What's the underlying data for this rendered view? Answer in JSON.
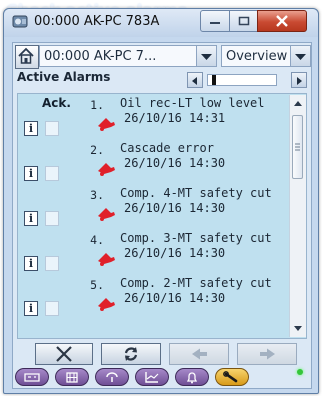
{
  "caption": "Check active alarms",
  "window": {
    "title": "00:000 AK-PC 783A",
    "minimize_label": "Minimize",
    "maximize_label": "Maximize",
    "close_label": "Close"
  },
  "toolbar": {
    "device_select": "00:000 AK-PC 7...",
    "view_select": "Overview"
  },
  "alarms": {
    "title": "Active Alarms",
    "ack_header": "Ack.",
    "info_label": "i",
    "items": [
      {
        "num": "1.",
        "text": "Oil rec-LT low level",
        "time": "26/10/16 14:31"
      },
      {
        "num": "2.",
        "text": "Cascade error",
        "time": "26/10/16 14:30"
      },
      {
        "num": "3.",
        "text": "Comp. 4-MT safety cut",
        "time": "26/10/16 14:30"
      },
      {
        "num": "4.",
        "text": "Comp. 3-MT safety cut",
        "time": "26/10/16 14:30"
      },
      {
        "num": "5.",
        "text": "Comp. 2-MT safety cut",
        "time": "26/10/16 14:30"
      }
    ]
  },
  "icons": {
    "home": "home-icon",
    "bell": "alarm-bell-icon",
    "delete": "x-icon",
    "refresh": "refresh-icon",
    "prev": "arrow-left-icon",
    "next": "arrow-right-icon",
    "nav": [
      "controller-icon",
      "grid-icon",
      "service-icon",
      "graph-icon",
      "alarm-bell-icon",
      "wrench-icon"
    ]
  },
  "colors": {
    "list_background": "#bfe0ef",
    "alarm_bell": "#e0202a",
    "nav_active": "#e8b234",
    "status_led": "#35c53a"
  }
}
